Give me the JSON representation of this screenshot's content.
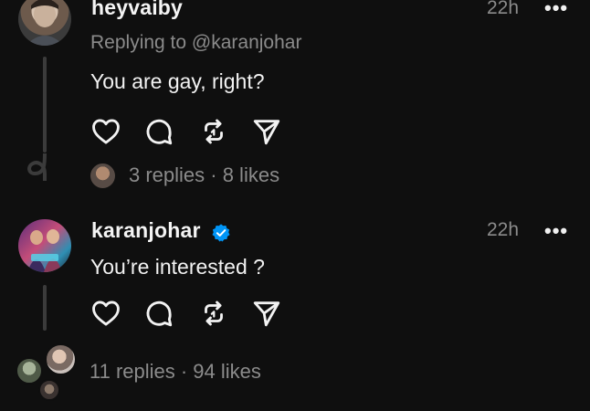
{
  "post1": {
    "username": "heyvaiby",
    "time": "22h",
    "more": "•••",
    "reply_context": "Replying to @karanjohar",
    "text": "You are gay, right?",
    "stats": "3 replies · 8 likes"
  },
  "post2": {
    "username": "karanjohar",
    "verified": true,
    "time": "22h",
    "more": "•••",
    "text": "You’re interested ?",
    "stats": "11 replies · 94 likes"
  },
  "icons": [
    "heart-icon",
    "comment-icon",
    "repost-icon",
    "share-icon"
  ],
  "colors": {
    "background": "#0f0f0f",
    "text": "#f3f3f3",
    "muted": "#8b8b8b",
    "verified": "#0095f6"
  }
}
